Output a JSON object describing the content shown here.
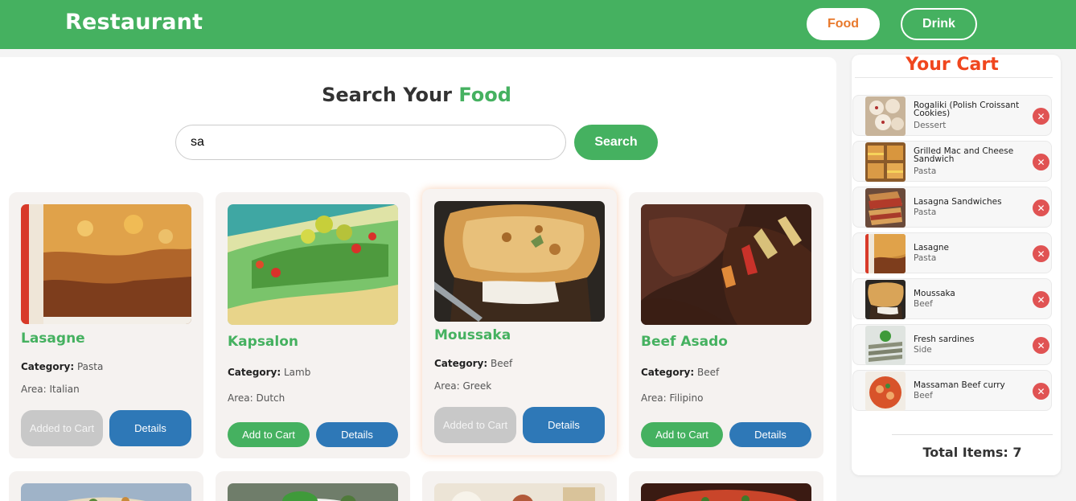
{
  "header": {
    "brand": "Restaurant",
    "nav": [
      {
        "label": "Food",
        "active": true
      },
      {
        "label": "Drink",
        "active": false
      }
    ]
  },
  "search": {
    "title_prefix": "Search Your",
    "title_accent": "Food",
    "value": "sa",
    "button_label": "Search"
  },
  "cards": [
    {
      "name": "Lasagne",
      "category_label": "Category:",
      "category": "Pasta",
      "area_label": "Area:",
      "area": "Italian",
      "primary_label": "Added to Cart",
      "primary_state": "added",
      "details_label": "Details"
    },
    {
      "name": "Kapsalon",
      "category_label": "Category:",
      "category": "Lamb",
      "area_label": "Area:",
      "area": "Dutch",
      "primary_label": "Add to Cart",
      "primary_state": "add",
      "details_label": "Details"
    },
    {
      "name": "Moussaka",
      "category_label": "Category:",
      "category": "Beef",
      "area_label": "Area:",
      "area": "Greek",
      "primary_label": "Added to Cart",
      "primary_state": "added",
      "details_label": "Details"
    },
    {
      "name": "Beef Asado",
      "category_label": "Category:",
      "category": "Beef",
      "area_label": "Area:",
      "area": "Filipino",
      "primary_label": "Add to Cart",
      "primary_state": "add",
      "details_label": "Details"
    }
  ],
  "cart": {
    "title": "Your Cart",
    "items": [
      {
        "name": "Rogaliki (Polish Croissant Cookies)",
        "category": "Dessert"
      },
      {
        "name": "Grilled Mac and Cheese Sandwich",
        "category": "Pasta"
      },
      {
        "name": "Lasagna Sandwiches",
        "category": "Pasta"
      },
      {
        "name": "Lasagne",
        "category": "Pasta"
      },
      {
        "name": "Moussaka",
        "category": "Beef"
      },
      {
        "name": "Fresh sardines",
        "category": "Side"
      },
      {
        "name": "Massaman Beef curry",
        "category": "Beef"
      }
    ],
    "remove_icon": "close-icon",
    "total_label": "Total Items: 7"
  },
  "colors": {
    "brand_green": "#45b160",
    "details_blue": "#2e78b7",
    "cart_title_red": "#f0461e",
    "remove_red": "#e05353",
    "food_nav_orange": "#e8792c"
  }
}
